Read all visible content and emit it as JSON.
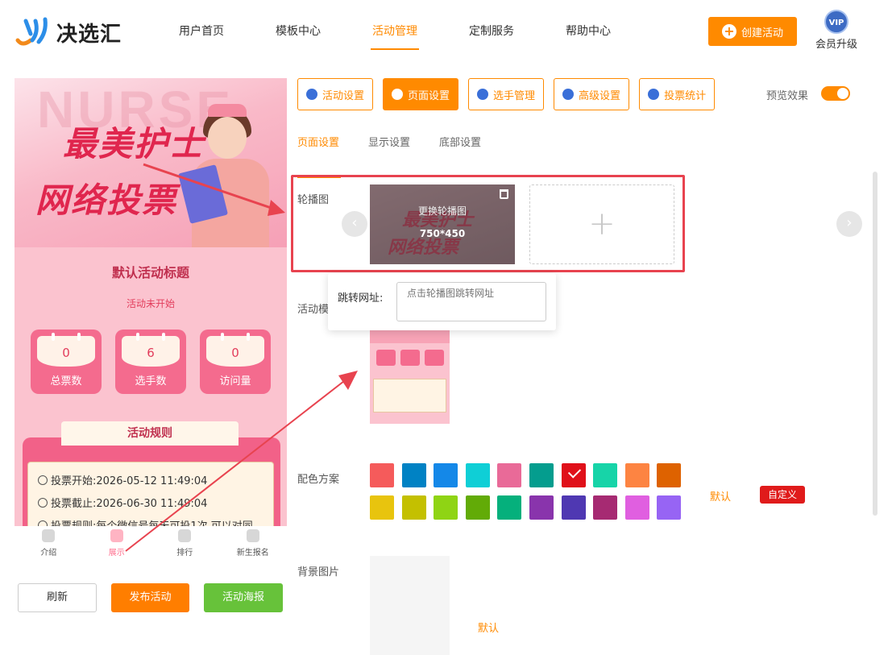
{
  "header": {
    "logo_text": "决选汇",
    "nav": [
      "用户首页",
      "模板中心",
      "活动管理",
      "定制服务",
      "帮助中心"
    ],
    "active_nav": "活动管理",
    "create_button": "创建活动",
    "vip_badge": "VIP",
    "vip_label": "会员升级"
  },
  "phone": {
    "banner_ghost": "NURSE",
    "banner_line1": "最美护士",
    "banner_line2": "网络投票",
    "activity_title": "默认活动标题",
    "activity_status": "活动未开始",
    "stats": [
      {
        "value": "0",
        "label": "总票数"
      },
      {
        "value": "6",
        "label": "选手数"
      },
      {
        "value": "0",
        "label": "访问量"
      }
    ],
    "rules_title": "活动规则",
    "rules": [
      "投票开始:2026-05-12 11:49:04",
      "投票截止:2026-06-30 11:49:04",
      "投票规则:每个微信号每天可投1次,可以对同"
    ],
    "tabbar": [
      "介绍",
      "展示",
      "排行",
      "新生报名"
    ],
    "active_tab": "展示"
  },
  "actions": {
    "refresh": "刷新",
    "publish": "发布活动",
    "poster": "活动海报"
  },
  "settings": {
    "tabs": [
      "活动设置",
      "页面设置",
      "选手管理",
      "高级设置",
      "投票统计"
    ],
    "active_tab": "页面设置",
    "preview_label": "预览效果",
    "preview_on": true,
    "subtabs": [
      "页面设置",
      "显示设置",
      "底部设置"
    ],
    "active_subtab": "页面设置",
    "carousel_label": "轮播图",
    "carousel_change": "更换轮播图",
    "carousel_size": "750*450",
    "carousel_add": "+",
    "url_label": "跳转网址:",
    "url_placeholder": "点击轮播图跳转网址",
    "template_label": "活动模",
    "color_label": "配色方案",
    "colors": [
      "#f55b5b",
      "#0082c4",
      "#1488e8",
      "#0fcfd6",
      "#e96a98",
      "#049d8e",
      "#e0101a",
      "#17d4a8",
      "#fd8442",
      "#de6200",
      "#e8c40e",
      "#c4c000",
      "#8fd414",
      "#62ab07",
      "#05b07c",
      "#8934ac",
      "#4f38b2",
      "#a62a72",
      "#e05fe0",
      "#9764f4"
    ],
    "selected_color": "#e0101a",
    "color_default": "默认",
    "color_custom": "自定义",
    "bg_label": "背景图片",
    "bg_default": "默认"
  }
}
